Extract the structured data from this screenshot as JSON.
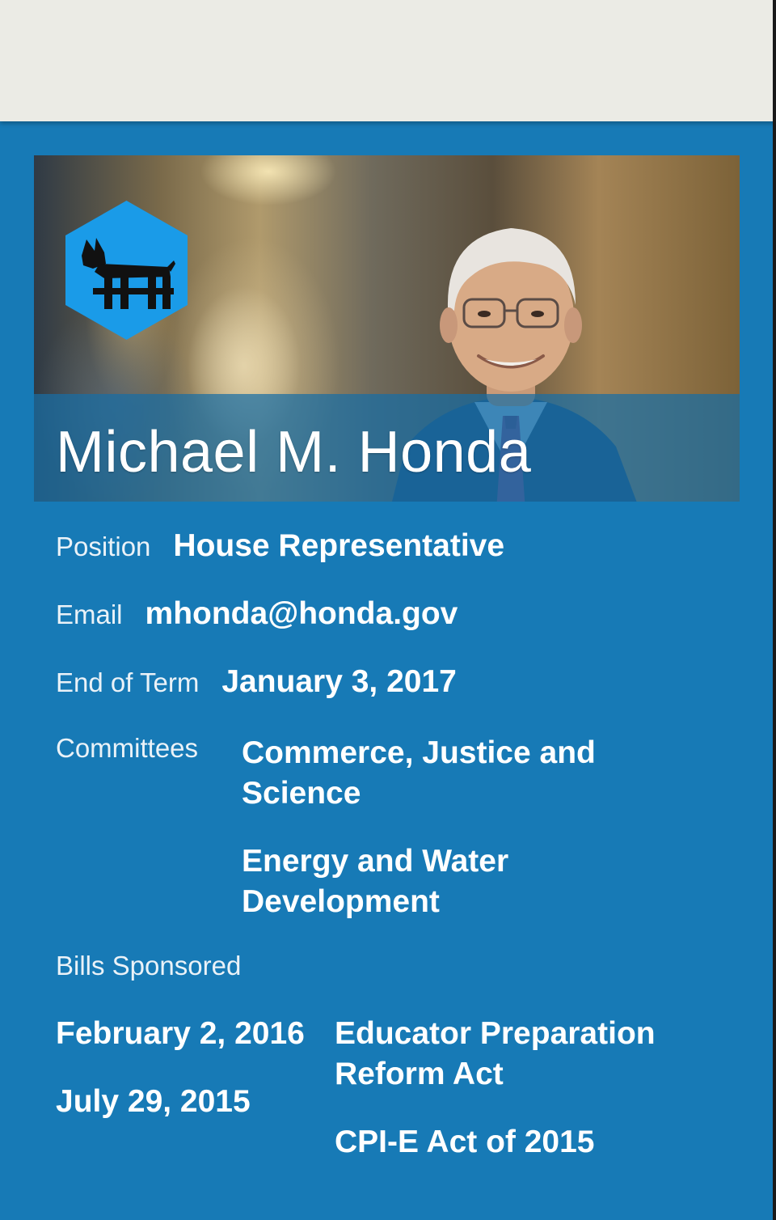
{
  "profile": {
    "name": "Michael M. Honda",
    "badge_icon": "dog-icon",
    "badge_color": "#1a9be8"
  },
  "details": {
    "position_label": "Position",
    "position_value": "House Representative",
    "email_label": "Email",
    "email_value": "mhonda@honda.gov",
    "term_label": "End of Term",
    "term_value": "January 3, 2017",
    "committees_label": "Committees",
    "committees": [
      "Commerce, Justice and Science",
      "Energy and Water Development"
    ]
  },
  "bills": {
    "label": "Bills Sponsored",
    "items": [
      {
        "date": "February 2, 2016",
        "title": "Educator Preparation Reform Act"
      },
      {
        "date": "July 29, 2015",
        "title": "CPI-E Act of 2015"
      }
    ]
  },
  "colors": {
    "background": "#177ab6",
    "top_bar": "#ebebe5"
  }
}
